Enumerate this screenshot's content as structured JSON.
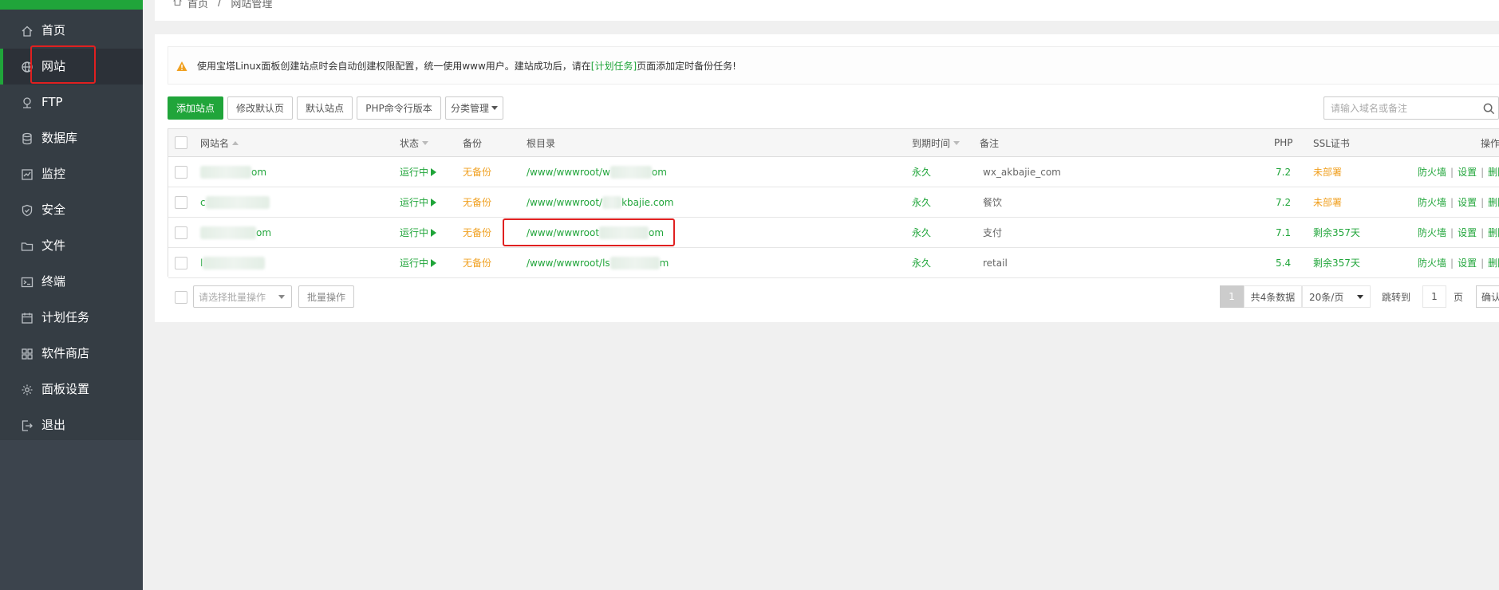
{
  "sidebar": {
    "items": [
      {
        "label": "首页",
        "icon": "home-icon"
      },
      {
        "label": "网站",
        "icon": "globe-icon",
        "active": true
      },
      {
        "label": "FTP",
        "icon": "ftp-icon"
      },
      {
        "label": "数据库",
        "icon": "database-icon"
      },
      {
        "label": "监控",
        "icon": "monitor-icon"
      },
      {
        "label": "安全",
        "icon": "shield-icon"
      },
      {
        "label": "文件",
        "icon": "folder-icon"
      },
      {
        "label": "终端",
        "icon": "terminal-icon"
      },
      {
        "label": "计划任务",
        "icon": "calendar-icon"
      },
      {
        "label": "软件商店",
        "icon": "apps-icon"
      },
      {
        "label": "面板设置",
        "icon": "gear-icon"
      },
      {
        "label": "退出",
        "icon": "logout-icon"
      }
    ]
  },
  "breadcrumb": {
    "home": "首页",
    "separator": "/",
    "current": "网站管理"
  },
  "notice": {
    "prefix": "使用宝塔Linux面板创建站点时会自动创建权限配置，统一使用www用户。建站成功后，请在",
    "link": "[计划任务]",
    "suffix": "页面添加定时备份任务!"
  },
  "toolbar": {
    "add_site": "添加站点",
    "edit_default_page": "修改默认页",
    "default_site": "默认站点",
    "php_cli_version": "PHP命令行版本",
    "category_manage": "分类管理",
    "search_placeholder": "请输入域名或备注"
  },
  "table": {
    "headers": {
      "name": "网站名",
      "status": "状态",
      "backup": "备份",
      "root": "根目录",
      "expire": "到期时间",
      "remark": "备注",
      "php": "PHP",
      "ssl": "SSL证书",
      "ops": "操作"
    },
    "rows": [
      {
        "name_suffix": "om",
        "status": "运行中",
        "backup": "无备份",
        "root_prefix": "/www/wwwroot/w",
        "root_suffix": "om",
        "expire": "永久",
        "remark": "wx_akbajie_com",
        "php": "7.2",
        "ssl": "未部署",
        "ssl_color": "#f0a020"
      },
      {
        "name_prefix": "c",
        "status": "运行中",
        "backup": "无备份",
        "root_prefix": "/www/wwwroot/",
        "root_suffix": "kbajie.com",
        "expire": "永久",
        "remark": "餐饮",
        "php": "7.2",
        "ssl": "未部署",
        "ssl_color": "#f0a020"
      },
      {
        "name_suffix": "om",
        "status": "运行中",
        "backup": "无备份",
        "root_prefix": "/www/wwwroot",
        "root_suffix": "om",
        "expire": "永久",
        "remark": "支付",
        "php": "7.1",
        "ssl": "剩余357天",
        "ssl_color": "#20a53a"
      },
      {
        "name_prefix": "l",
        "status": "运行中",
        "backup": "无备份",
        "root_prefix": "/www/wwwroot/ls",
        "root_suffix": "m",
        "expire": "永久",
        "remark": "retail",
        "php": "5.4",
        "ssl": "剩余357天",
        "ssl_color": "#20a53a"
      }
    ],
    "ops": {
      "firewall": "防火墙",
      "settings": "设置",
      "delete": "删除",
      "sep": "|"
    }
  },
  "bottom": {
    "batch_placeholder": "请选择批量操作",
    "batch_button": "批量操作",
    "current_page": "1",
    "total": "共4条数据",
    "page_size": "20条/页",
    "jump_to": "跳转到",
    "jump_value": "1",
    "page_unit": "页",
    "confirm": "确认"
  },
  "colors": {
    "accent": "#20a53a",
    "warning": "#f0a020",
    "sidebar_bg": "#3c444d",
    "highlight": "#e02020"
  }
}
